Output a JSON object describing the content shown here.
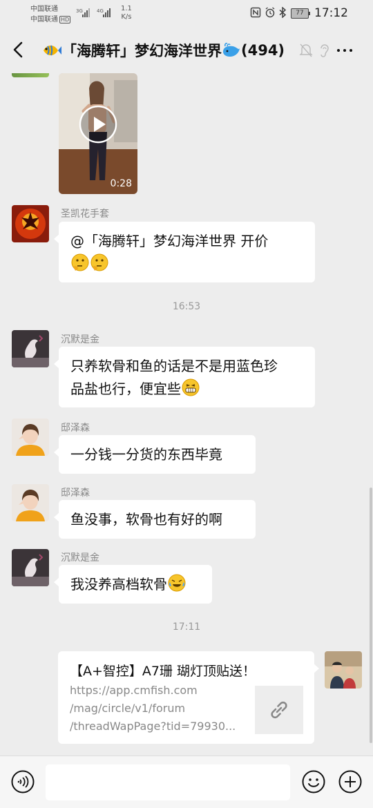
{
  "status_bar": {
    "carrier_1": "中国联通",
    "carrier_2": "中国联通",
    "hd_badge": "HD",
    "sig1_label": "3G",
    "sig2_label": "4G",
    "speed_value": "1.1",
    "speed_unit": "K/s",
    "battery": "77",
    "time": "17:12"
  },
  "header": {
    "title": "「海腾轩」梦幻海洋世界",
    "member_count": "(494)"
  },
  "messages": [
    {
      "type": "video",
      "duration": "0:28"
    },
    {
      "type": "text",
      "sender": "圣凯花手套",
      "text": "@「海腾轩」梦幻海洋世界  开价"
    },
    {
      "type": "time",
      "text": "16:53"
    },
    {
      "type": "text",
      "sender": "沉默是金",
      "text_line1": "只养软骨和鱼的话是不是用蓝色珍",
      "text_line2": "品盐也行，便宜些"
    },
    {
      "type": "text",
      "sender": "邸泽森",
      "text": "一分钱一分货的东西毕竟"
    },
    {
      "type": "text",
      "sender": "邸泽森",
      "text": "鱼没事，软骨也有好的啊"
    },
    {
      "type": "text",
      "sender": "沉默是金",
      "text": "我没养高档软骨"
    },
    {
      "type": "time",
      "text": "17:11"
    },
    {
      "type": "link",
      "title": "【A+智控】A7珊 瑚灯顶贴送！",
      "url_line1": "https://app.cmfish.com",
      "url_line2": "/mag/circle/v1/forum",
      "url_line3": "/threadWapPage?tid=79930..."
    }
  ],
  "input": {
    "placeholder": ""
  },
  "colors": {
    "background": "#ededed",
    "bubble": "#ffffff",
    "meta_text": "#888888"
  },
  "icons": [
    "back-arrow-icon",
    "fish-emoji-icon",
    "whale-emoji-icon",
    "mute-bell-icon",
    "ear-icon",
    "more-icon",
    "voice-icon",
    "emoji-face-icon",
    "plus-icon",
    "link-icon",
    "play-icon"
  ]
}
